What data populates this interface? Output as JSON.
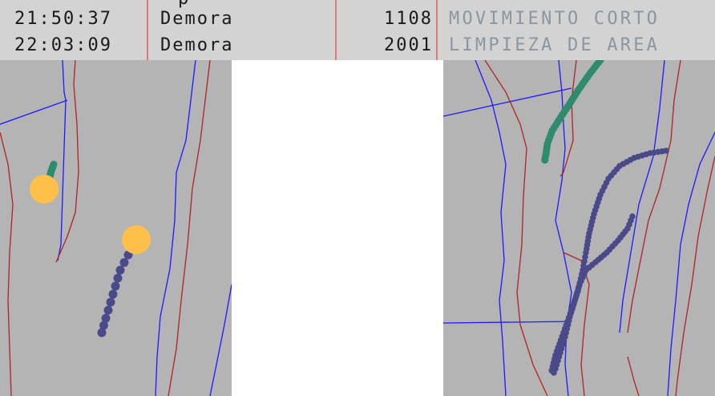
{
  "log": {
    "rows": [
      {
        "time": "21:50:37",
        "type": "Demora",
        "code": "1108",
        "description": "MOVIMIENTO CORTO"
      },
      {
        "time": "22:03:09",
        "type": "Demora",
        "code": "2001",
        "description": "LIMPIEZA DE AREA"
      }
    ]
  },
  "colors": {
    "header_background": "#d3d3d3",
    "column_divider": "#e07a7a",
    "map_background": "#b4b4b4",
    "boundary_blue": "#1a1aff",
    "boundary_red": "#b22222",
    "track_green": "#2e8b6e",
    "track_navy": "#4a4a8a",
    "marker_yellow": "#ffc04a",
    "description_text": "#8a96a0"
  },
  "icons": {
    "vehicle_marker": "yellow-circle-marker",
    "track_point": "dot"
  }
}
